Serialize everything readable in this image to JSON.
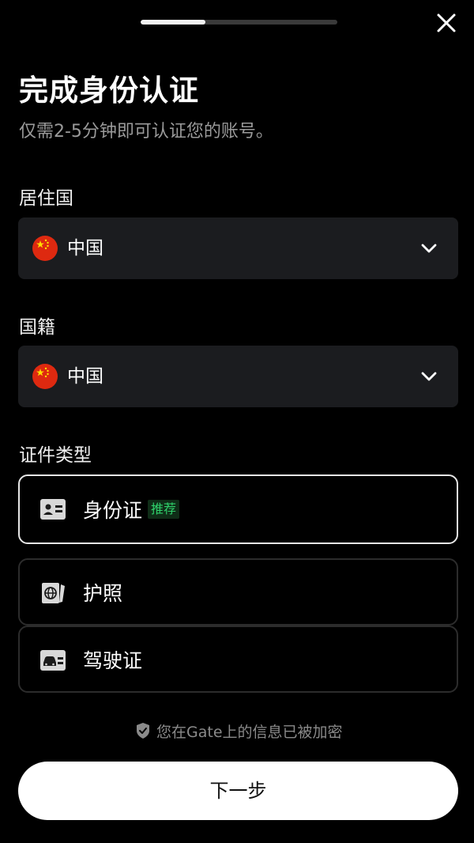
{
  "progress": {
    "fraction": 0.33
  },
  "header": {
    "title": "完成身份认证",
    "subtitle": "仅需2-5分钟即可认证您的账号。"
  },
  "residence": {
    "label": "居住国",
    "value": "中国"
  },
  "nationality": {
    "label": "国籍",
    "value": "中国"
  },
  "document_type": {
    "label": "证件类型",
    "options": [
      {
        "label": "身份证",
        "badge": "推荐",
        "selected": true,
        "icon": "id-card-icon"
      },
      {
        "label": "护照",
        "selected": false,
        "icon": "passport-icon"
      },
      {
        "label": "驾驶证",
        "selected": false,
        "icon": "driver-license-icon"
      }
    ]
  },
  "security_note": "您在Gate上的信息已被加密",
  "next_button": "下一步",
  "colors": {
    "badge_green": "#2fcf6a",
    "badge_bg": "#0f2d17",
    "flag_red": "#de2910",
    "flag_star": "#ffde00"
  }
}
